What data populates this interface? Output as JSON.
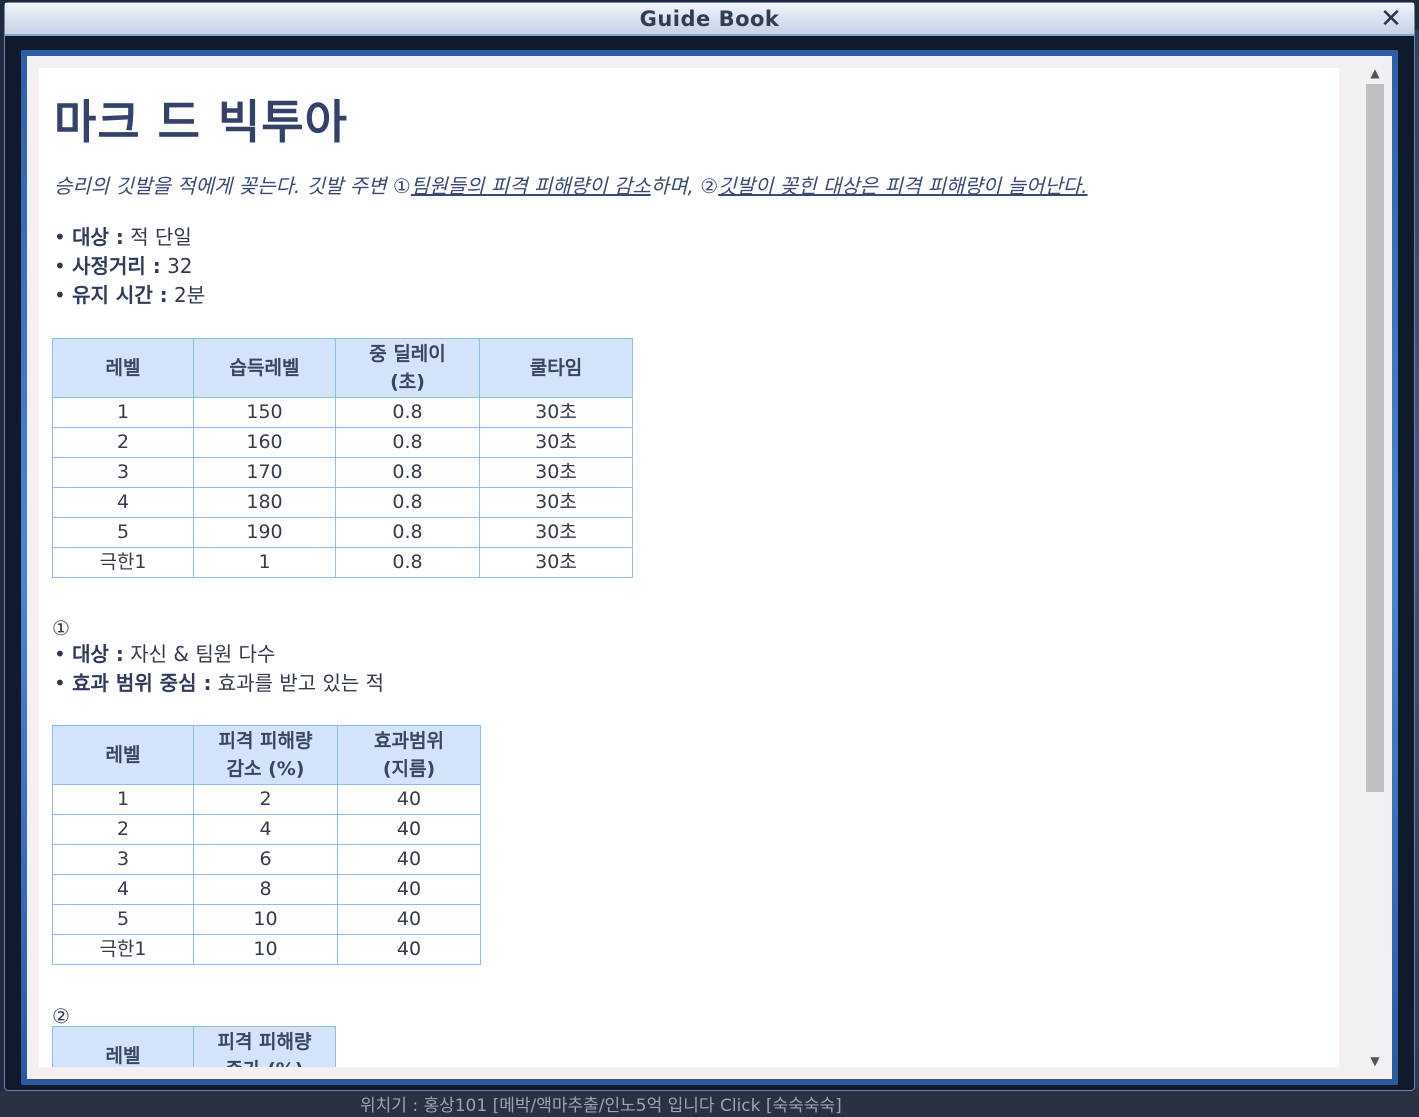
{
  "background": {
    "status_text": "위치기 : 홍상101 [메박/액마추출/인노5억 입니다 Click [숙숙숙숙]"
  },
  "window": {
    "title": "Guide Book",
    "close_glyph": "✕"
  },
  "skill": {
    "name": "마크 드 빅투아",
    "description_plain": "승리의 깃발을 적에게 꽂는다. 깃발 주변 ①",
    "description_u1": "팀원들의 피격 피해량이 감소",
    "description_mid": "하며, ②",
    "description_u2": "깃발이 꽂힌 대상은 피격 피해량이 늘어난다.",
    "info": [
      {
        "label": "대상 :",
        "value": " 적 단일"
      },
      {
        "label": "사정거리 :",
        "value": " 32"
      },
      {
        "label": "유지 시간 :",
        "value": " 2분"
      }
    ],
    "table1": {
      "headers": [
        "레벨",
        "습득레벨",
        "중 딜레이",
        "(초)",
        "쿨타임"
      ],
      "rows": [
        [
          "1",
          "150",
          "0.8",
          "30초"
        ],
        [
          "2",
          "160",
          "0.8",
          "30초"
        ],
        [
          "3",
          "170",
          "0.8",
          "30초"
        ],
        [
          "4",
          "180",
          "0.8",
          "30초"
        ],
        [
          "5",
          "190",
          "0.8",
          "30초"
        ],
        [
          "극한1",
          "1",
          "0.8",
          "30초"
        ]
      ]
    },
    "effect1": {
      "marker": "①",
      "info": [
        {
          "label": "대상 :",
          "value": " 자신 & 팀원 다수"
        },
        {
          "label": "효과 범위 중심 :",
          "value": " 효과를 받고 있는 적"
        }
      ],
      "headers": [
        "레벨",
        "피격 피해량",
        "감소 (%)",
        "효과범위",
        "(지름)"
      ],
      "rows": [
        [
          "1",
          "2",
          "40"
        ],
        [
          "2",
          "4",
          "40"
        ],
        [
          "3",
          "6",
          "40"
        ],
        [
          "4",
          "8",
          "40"
        ],
        [
          "5",
          "10",
          "40"
        ],
        [
          "극한1",
          "10",
          "40"
        ]
      ]
    },
    "effect2": {
      "marker": "②",
      "headers": [
        "레벨",
        "피격 피해량",
        "증가 (%)"
      ]
    }
  },
  "scrollbar": {
    "up_glyph": "▲",
    "down_glyph": "▼",
    "position": 0
  }
}
